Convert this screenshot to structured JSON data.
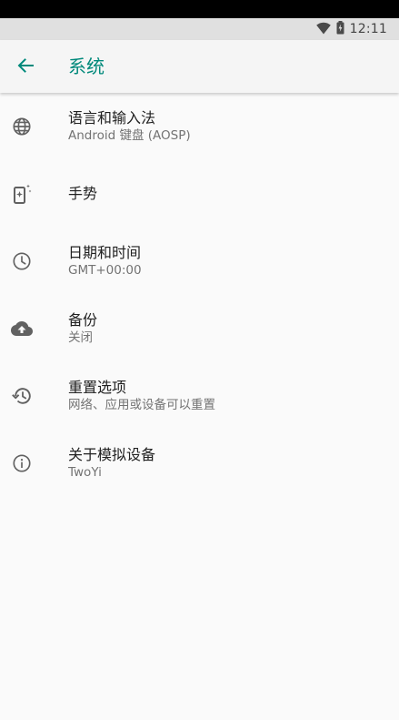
{
  "status_bar": {
    "time": "12:11",
    "icons": [
      "wifi-icon",
      "battery-icon"
    ]
  },
  "app_bar": {
    "back_icon": "arrow-back-icon",
    "title": "系统"
  },
  "settings": [
    {
      "icon": "globe-icon",
      "title": "语言和输入法",
      "subtitle": "Android 键盘 (AOSP)"
    },
    {
      "icon": "gesture-phone-icon",
      "title": "手势",
      "subtitle": ""
    },
    {
      "icon": "clock-icon",
      "title": "日期和时间",
      "subtitle": "GMT+00:00"
    },
    {
      "icon": "cloud-upload-icon",
      "title": "备份",
      "subtitle": "关闭"
    },
    {
      "icon": "restore-icon",
      "title": "重置选项",
      "subtitle": "网络、应用或设备可以重置"
    },
    {
      "icon": "info-icon",
      "title": "关于模拟设备",
      "subtitle": "TwoYi"
    }
  ],
  "colors": {
    "accent": "#00897b",
    "background": "#fafafa",
    "app_bar": "#f5f5f5",
    "status_bar": "#e0e0e0",
    "icon": "#616161",
    "title_text": "#212121",
    "subtitle_text": "#737373"
  }
}
